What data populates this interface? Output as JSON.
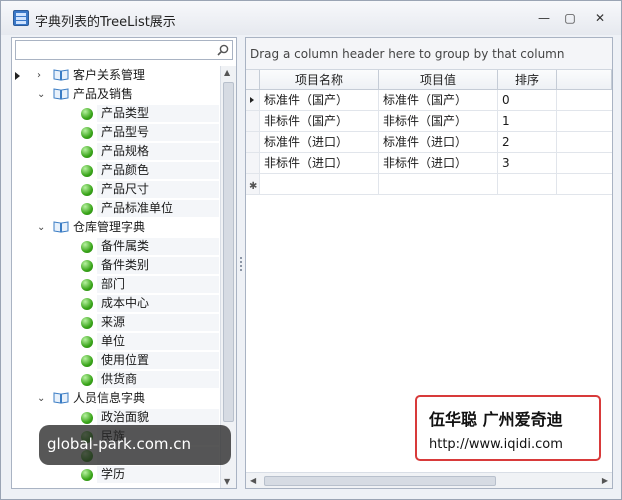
{
  "window": {
    "title": "字典列表的TreeList展示",
    "minimize_glyph": "—",
    "maximize_glyph": "▢",
    "close_glyph": "✕"
  },
  "search": {
    "value": "",
    "placeholder": "",
    "icon": "search-icon"
  },
  "tree": {
    "nodes": [
      {
        "label": "客户关系管理",
        "expanded": false,
        "children": []
      },
      {
        "label": "产品及销售",
        "expanded": true,
        "children": [
          "产品类型",
          "产品型号",
          "产品规格",
          "产品颜色",
          "产品尺寸",
          "产品标准单位"
        ]
      },
      {
        "label": "仓库管理字典",
        "expanded": true,
        "children": [
          "备件属类",
          "备件类别",
          "部门",
          "成本中心",
          "来源",
          "单位",
          "使用位置",
          "供货商"
        ]
      },
      {
        "label": "人员信息字典",
        "expanded": true,
        "children": [
          "政治面貌",
          "民族",
          "",
          "学历"
        ]
      }
    ]
  },
  "grid": {
    "group_panel_text": "Drag a column header here to group by that column",
    "columns": [
      "项目名称",
      "项目值",
      "排序"
    ],
    "rows": [
      [
        "标准件（国产）",
        "标准件（国产）",
        "0"
      ],
      [
        "非标件（国产）",
        "非标件（国产）",
        "1"
      ],
      [
        "标准件（进口）",
        "标准件（进口）",
        "2"
      ],
      [
        "非标件（进口）",
        "非标件（进口）",
        "3"
      ]
    ],
    "new_row_glyph": "✱"
  },
  "credit": {
    "name": "伍华聪 广州爱奇迪",
    "url": "http://www.iqidi.com"
  },
  "watermark": {
    "text": "global-park.com.cn"
  },
  "colors": {
    "node_dot": "#3aa51a",
    "book_icon": "#3a7cc4",
    "credit_border": "#d83a3a"
  }
}
